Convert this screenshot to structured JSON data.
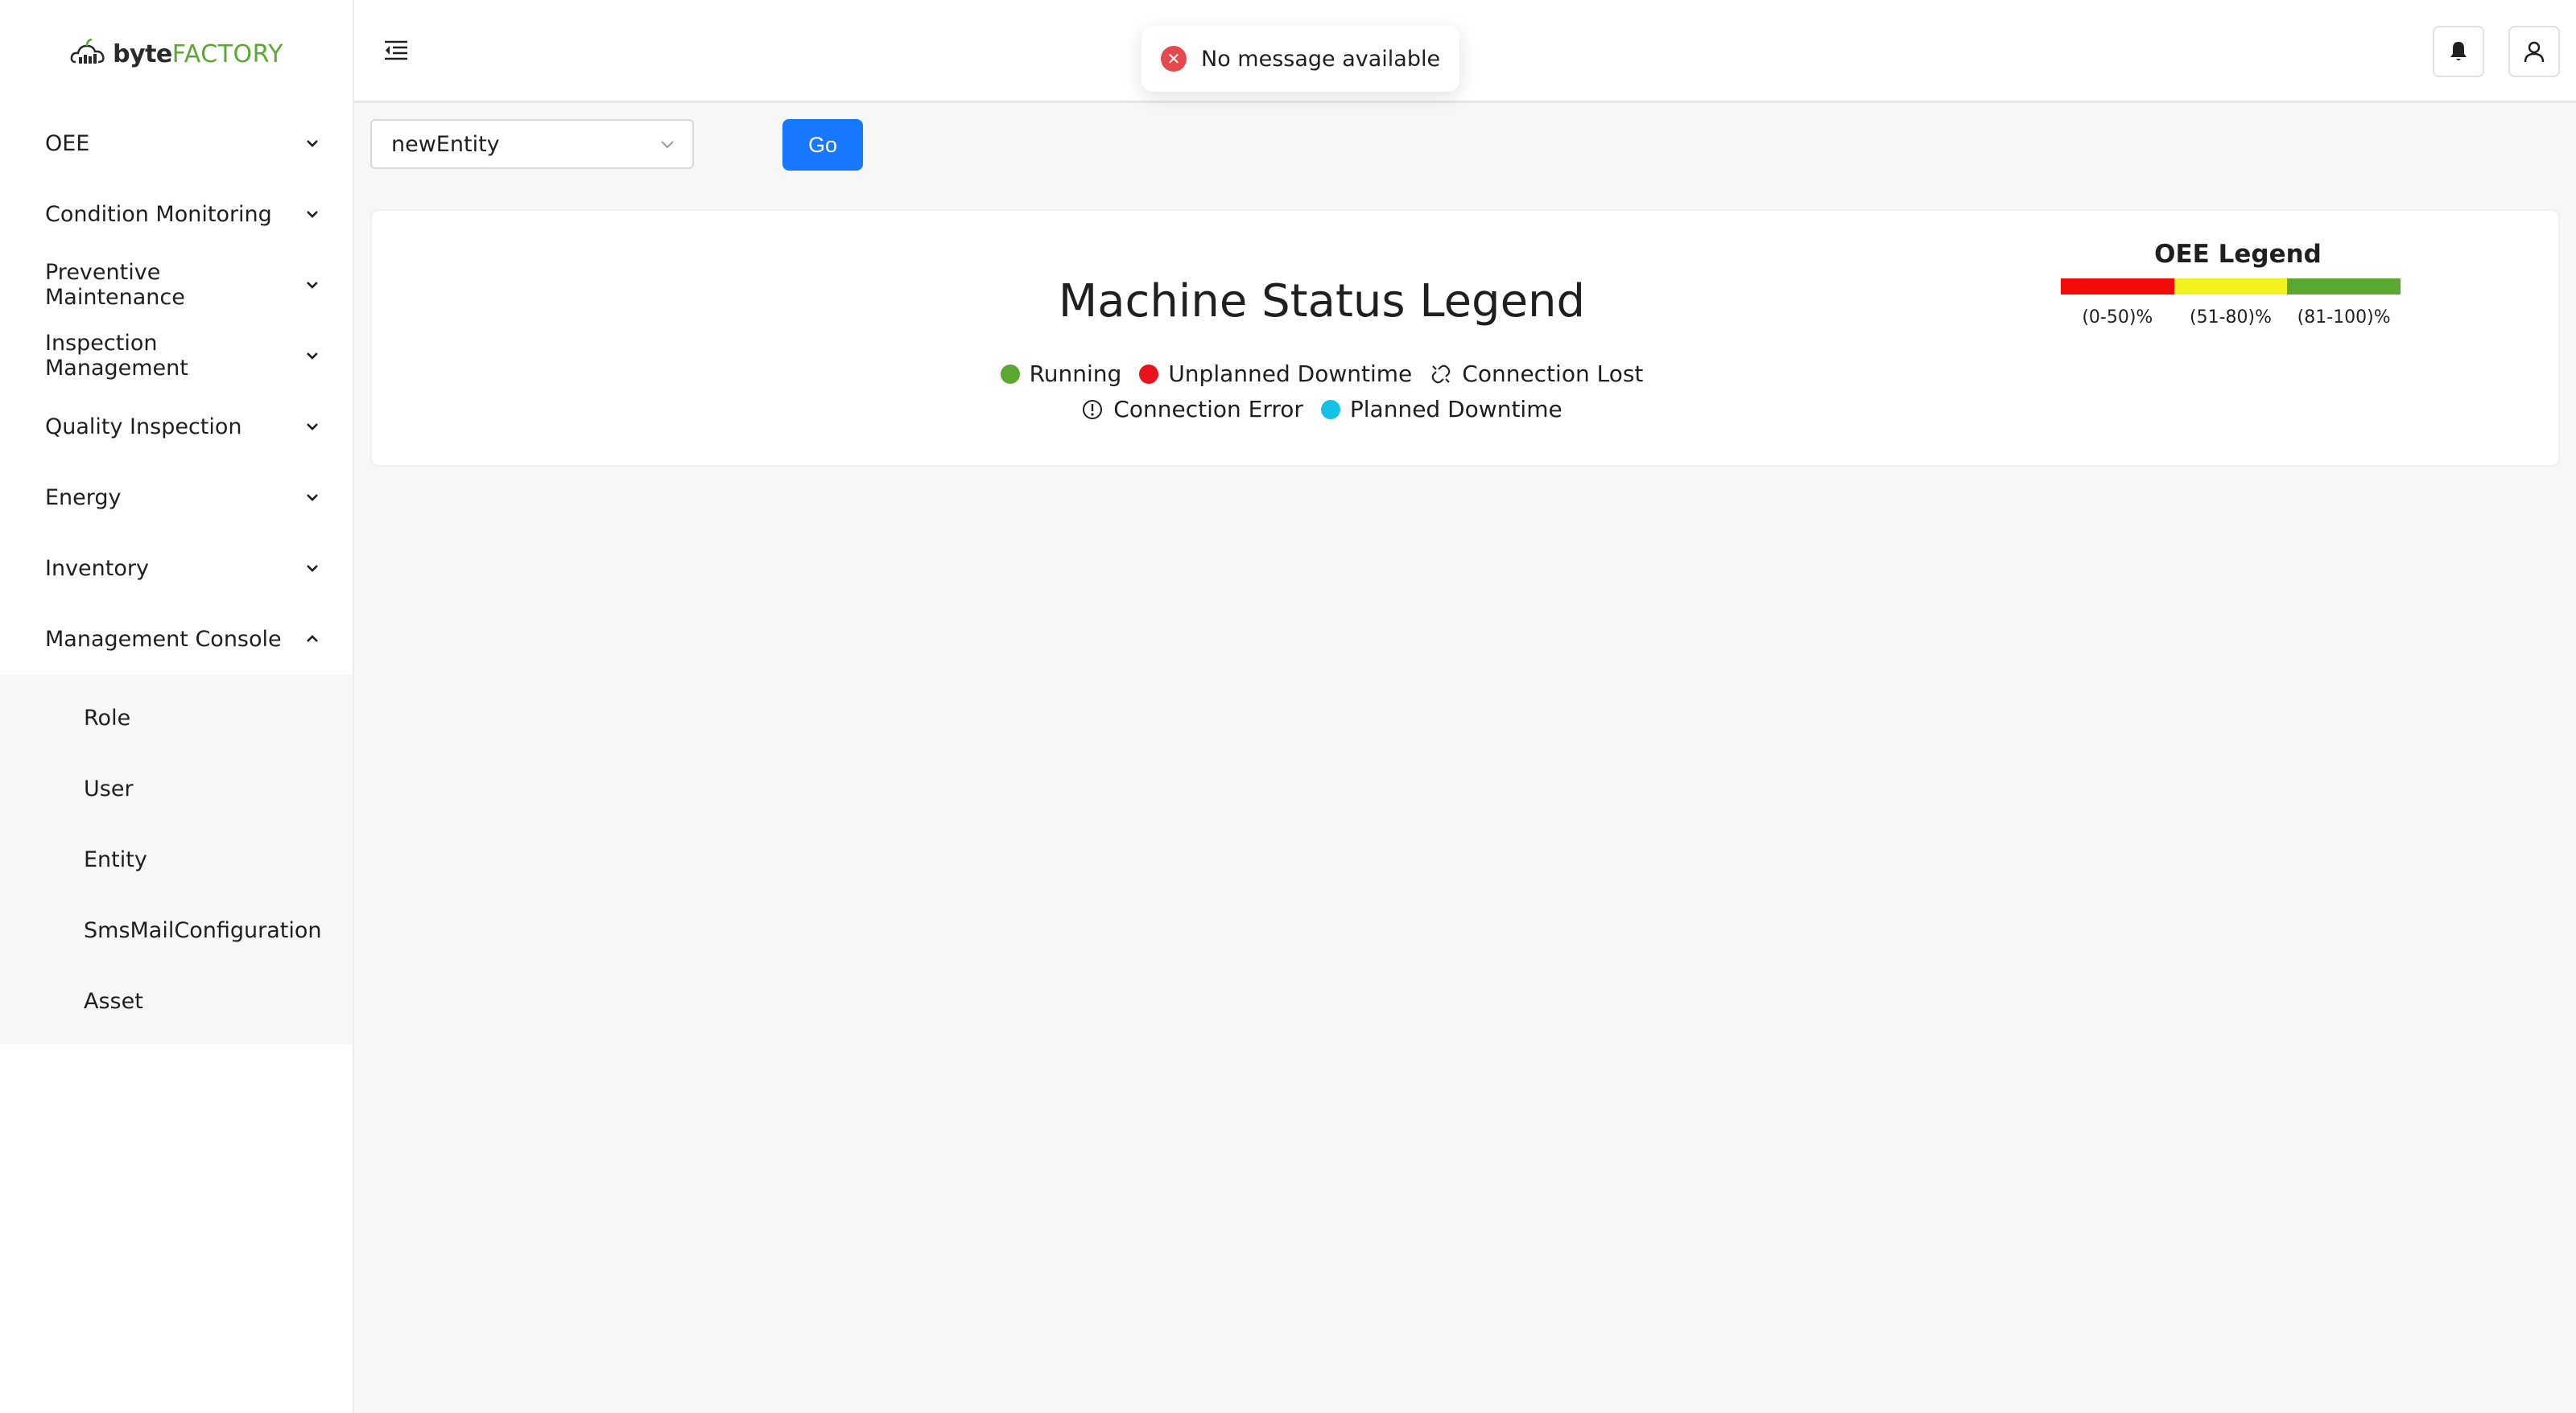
{
  "brand": {
    "name_bold": "byte",
    "name_light": "FACTORY"
  },
  "sidebar": {
    "items": [
      {
        "label": "OEE"
      },
      {
        "label": "Condition Monitoring"
      },
      {
        "label": "Preventive Maintenance"
      },
      {
        "label": "Inspection Management"
      },
      {
        "label": "Quality Inspection"
      },
      {
        "label": "Energy"
      },
      {
        "label": "Inventory"
      },
      {
        "label": "Management Console",
        "expanded": true
      }
    ],
    "submenu": [
      {
        "label": "Role"
      },
      {
        "label": "User"
      },
      {
        "label": "Entity"
      },
      {
        "label": "SmsMailConfiguration"
      },
      {
        "label": "Asset"
      }
    ]
  },
  "toast": {
    "message": "No message available",
    "type": "error"
  },
  "filter": {
    "entity_value": "newEntity",
    "go_label": "Go"
  },
  "machine_legend": {
    "title": "Machine Status Legend",
    "statuses": [
      {
        "label": "Running",
        "color": "#5aa832",
        "icon": "dot"
      },
      {
        "label": "Unplanned Downtime",
        "color": "#e8141c",
        "icon": "dot"
      },
      {
        "label": "Connection Lost",
        "icon": "broken-link-icon"
      },
      {
        "label": "Connection Error",
        "icon": "exclamation-circle-icon"
      },
      {
        "label": "Planned Downtime",
        "color": "#13c2e6",
        "icon": "dot"
      }
    ]
  },
  "oee_legend": {
    "title": "OEE Legend",
    "ranges": [
      {
        "label": "(0-50)%",
        "color": "#f50a0a"
      },
      {
        "label": "(51-80)%",
        "color": "#f2f21e"
      },
      {
        "label": "(81-100)%",
        "color": "#5aa832"
      }
    ]
  },
  "colors": {
    "accent": "#1677ff",
    "brand_green": "#5aa832"
  }
}
